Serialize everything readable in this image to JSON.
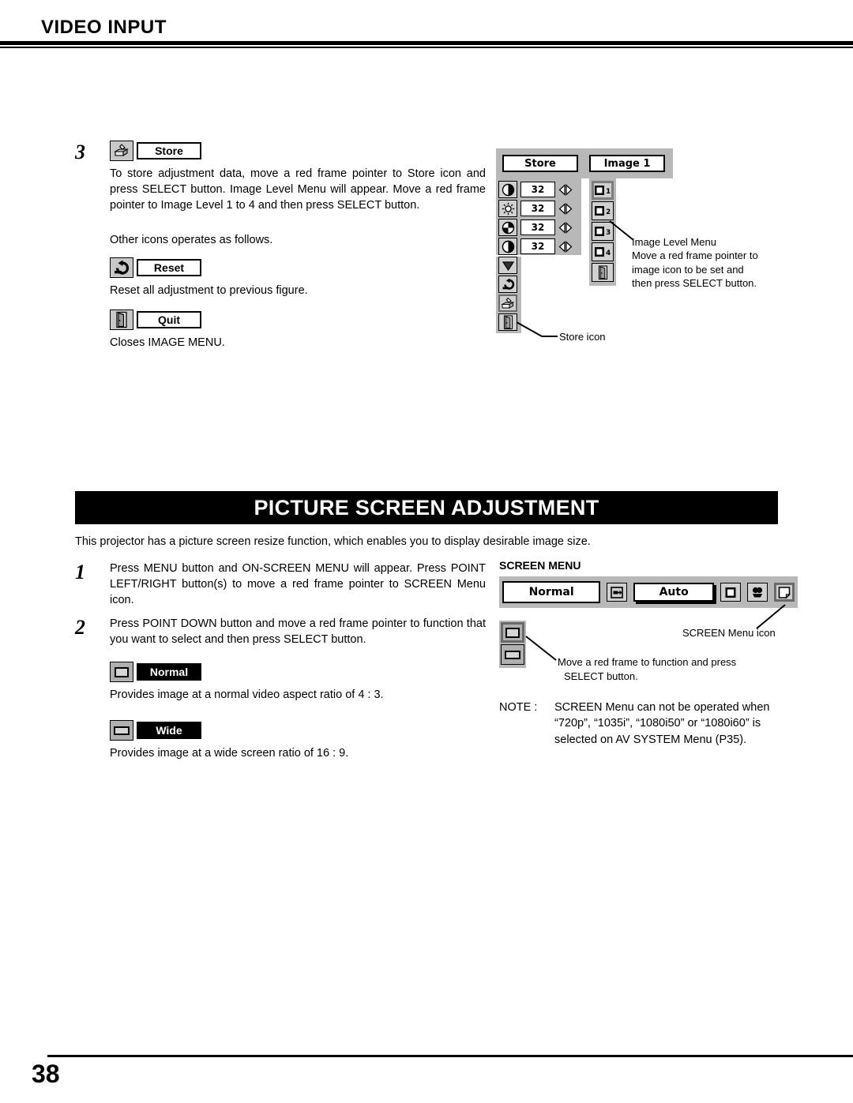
{
  "header": {
    "title": "VIDEO INPUT"
  },
  "step3": {
    "number": "3",
    "store_label": "Store",
    "store_icon": "store-icon",
    "paragraph": "To store adjustment data, move a red frame pointer to Store icon and press SELECT button.  Image Level Menu will appear. Move a red frame pointer to Image Level 1 to 4 and then press SELECT button.",
    "other_icons_intro": "Other icons operates as follows.",
    "reset_label": "Reset",
    "reset_icon": "reset-arrow-icon",
    "reset_desc": "Reset all adjustment to previous figure.",
    "quit_label": "Quit",
    "quit_icon": "door-exit-icon",
    "quit_desc": "Closes IMAGE MENU."
  },
  "image_menu": {
    "store_field": "Store",
    "image_field": "Image 1",
    "sliders": [
      {
        "icon": "contrast-icon",
        "value": "32"
      },
      {
        "icon": "brightness-icon",
        "value": "32"
      },
      {
        "icon": "color-icon",
        "value": "32"
      },
      {
        "icon": "tint-icon",
        "value": "32"
      }
    ],
    "stack_icons": [
      "down-arrow-icon",
      "reset-arrow-icon",
      "store-icon",
      "door-exit-icon"
    ],
    "levels": [
      "1",
      "2",
      "3",
      "4"
    ],
    "level_quit_icon": "door-exit-icon",
    "callout_image_level": "Image Level Menu\nMove a red frame pointer to\nimage icon to be set and\nthen press SELECT button.",
    "callout_image_level_lines": [
      "Image Level Menu",
      "Move a red frame pointer to",
      "image icon to be set and",
      "then press SELECT button."
    ],
    "callout_store_icon": "Store icon"
  },
  "banner": {
    "title": "PICTURE SCREEN ADJUSTMENT"
  },
  "intro": {
    "text": "This projector has a picture screen resize function, which enables you to display desirable image size."
  },
  "steps": [
    {
      "number": "1",
      "text": "Press MENU button and ON-SCREEN MENU will appear.  Press POINT LEFT/RIGHT button(s) to move a red frame pointer to SCREEN Menu icon."
    },
    {
      "number": "2",
      "text": "Press POINT DOWN button and move a red frame pointer to function that you want to select and then press SELECT button."
    }
  ],
  "modes": [
    {
      "label": "Normal",
      "icon": "screen-normal-icon",
      "desc": "Provides image at a normal video aspect ratio of 4 : 3."
    },
    {
      "label": "Wide",
      "icon": "screen-wide-icon",
      "desc": "Provides image at a wide screen ratio of 16 : 9."
    }
  ],
  "screen_menu": {
    "heading": "SCREEN MENU",
    "normal_field": "Normal",
    "auto_field": "Auto",
    "bar_icons": [
      "input-source-icon",
      "screen-square-icon",
      "color-adjust-icon",
      "screen-menu-icon"
    ],
    "stack_icons": [
      "screen-normal-icon",
      "screen-wide-icon"
    ],
    "callout_screen_icon": "SCREEN Menu icon",
    "callout_move_frame_lines": [
      "Move a red frame to function and press",
      "SELECT button."
    ],
    "note_lead": "NOTE :",
    "note_lines": [
      "SCREEN Menu can not be operated when",
      "“720p”, “1035i”, “1080i50” or “1080i60” is",
      "selected on AV SYSTEM Menu (P35)."
    ]
  },
  "footer": {
    "page_number": "38"
  },
  "colors": {
    "menu_gray": "#b8b8b8",
    "icon_gray": "#d0d0d0",
    "black": "#000000",
    "white": "#ffffff"
  }
}
